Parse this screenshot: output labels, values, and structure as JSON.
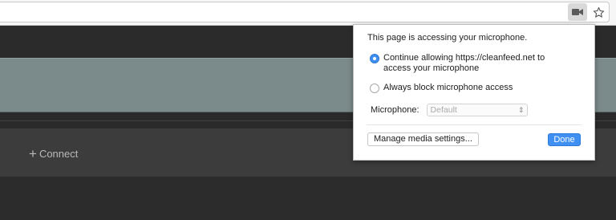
{
  "toolbar": {
    "camera_icon": "video-camera-icon",
    "star_icon": "bookmark-star-icon"
  },
  "page": {
    "connect_label": "Connect",
    "connect_icon": "plus-icon"
  },
  "popup": {
    "title": "This page is accessing your microphone.",
    "option_allow_line1": "Continue allowing https://cleanfeed.net to",
    "option_allow_line2": "access your microphone",
    "option_block": "Always block microphone access",
    "selected_option": "allow",
    "microphone_label": "Microphone:",
    "microphone_value": "Default",
    "manage_button": "Manage media settings...",
    "done_button": "Done"
  },
  "colors": {
    "accent": "#3f90f2",
    "page_gray_band": "#7b8a8a",
    "page_dark": "#2c2c2c"
  }
}
